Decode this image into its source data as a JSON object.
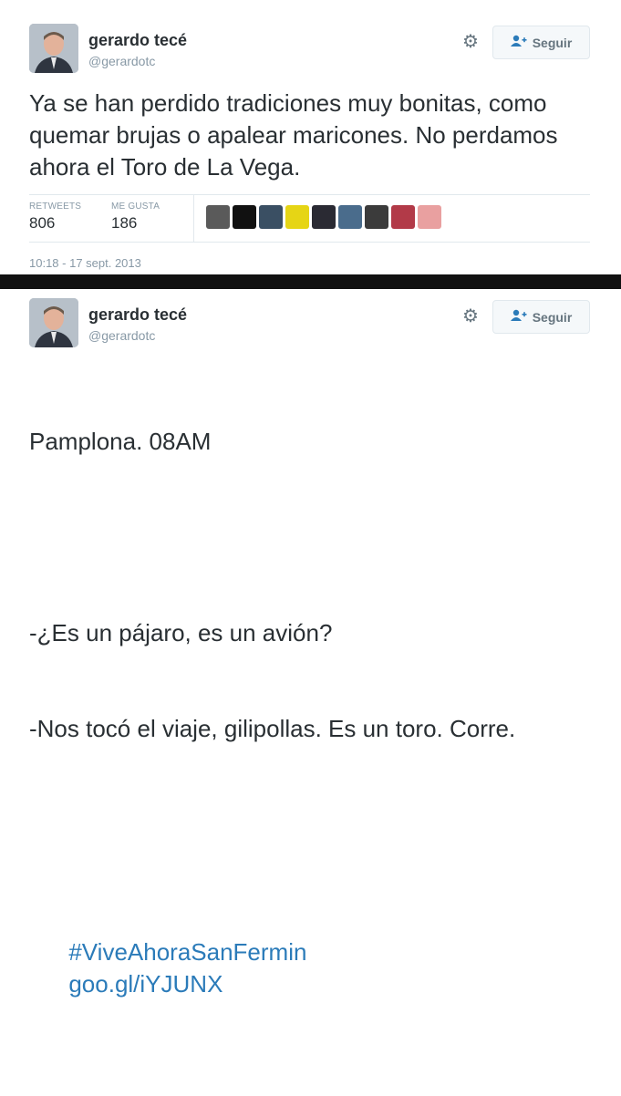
{
  "tweets": [
    {
      "author": {
        "name": "gerardo tecé",
        "handle": "@gerardotc"
      },
      "follow_label": "Seguir",
      "text": "Ya se han perdido tradiciones muy bonitas, como quemar brujas o apalear maricones. No perdamos ahora el Toro de La Vega.",
      "stats": {
        "retweets_label": "RETWEETS",
        "retweets_value": "806",
        "likes_label": "ME GUSTA",
        "likes_value": "186"
      },
      "likers_count": 9,
      "timestamp": "10:18 - 17 sept. 2013"
    },
    {
      "author": {
        "name": "gerardo tecé",
        "handle": "@gerardotc"
      },
      "follow_label": "Seguir",
      "text_lines": [
        "Pamplona. 08AM",
        "",
        "-¿Es un pájaro, es un avión?",
        "-Nos tocó el viaje, gilipollas. Es un toro. Corre.",
        ""
      ],
      "hashtag": "#ViveAhoraSanFermin",
      "link": "goo.gl/iYJUNX"
    }
  ],
  "icons": {
    "settings": "gear-icon",
    "follow": "add-user-icon"
  },
  "colors": {
    "link": "#2b7bb9",
    "muted": "#8899a6",
    "text": "#292f33",
    "divider": "#111111"
  }
}
